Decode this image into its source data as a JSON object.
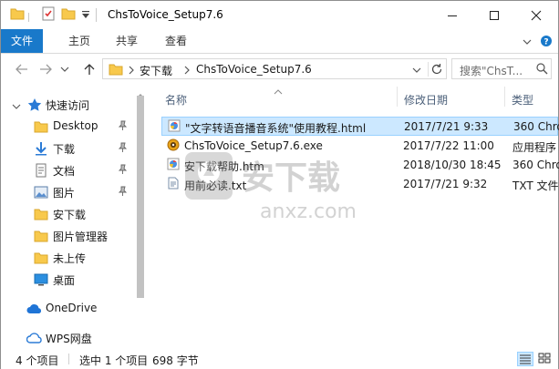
{
  "window": {
    "title": "ChsToVoice_Setup7.6"
  },
  "ribbon": {
    "tabs": [
      "文件",
      "主页",
      "共享",
      "查看"
    ]
  },
  "address": {
    "crumbs": [
      "安下载",
      "ChsToVoice_Setup7.6"
    ],
    "search_placeholder": "搜索\"ChsT..."
  },
  "sidebar": {
    "items": [
      {
        "label": "快速访问",
        "icon": "star-icon"
      },
      {
        "label": "Desktop",
        "icon": "folder-icon"
      },
      {
        "label": "下载",
        "icon": "download-icon"
      },
      {
        "label": "文档",
        "icon": "document-icon"
      },
      {
        "label": "图片",
        "icon": "picture-icon"
      },
      {
        "label": "安下载",
        "icon": "folder-icon"
      },
      {
        "label": "图片管理器",
        "icon": "folder-icon"
      },
      {
        "label": "未上传",
        "icon": "folder-icon"
      },
      {
        "label": "桌面",
        "icon": "desktop-icon"
      },
      {
        "label": "OneDrive",
        "icon": "cloud-icon"
      },
      {
        "label": "WPS网盘",
        "icon": "cloud-icon"
      }
    ]
  },
  "columns": {
    "name": "名称",
    "modified": "修改日期",
    "type": "类型"
  },
  "files": [
    {
      "name": "\"文字转语音播音系统\"使用教程.html",
      "modified": "2017/7/21 9:33",
      "type": "360 Chro",
      "icon": "html-icon",
      "selected": true
    },
    {
      "name": "ChsToVoice_Setup7.6.exe",
      "modified": "2017/7/22 11:00",
      "type": "应用程序",
      "icon": "exe-icon",
      "selected": false
    },
    {
      "name": "安下载帮助.htm",
      "modified": "2018/10/30 18:45",
      "type": "360 Chro",
      "icon": "html-icon",
      "selected": false
    },
    {
      "name": "用前必读.txt",
      "modified": "2017/7/21 9:32",
      "type": "TXT 文件",
      "icon": "txt-icon",
      "selected": false
    }
  ],
  "status": {
    "count": "4 个项目",
    "selection": "选中 1 个项目",
    "size": "698 字节"
  },
  "watermark": {
    "text": "安下载",
    "url": "anxz.com"
  },
  "colors": {
    "accent": "#1979ca",
    "selection_bg": "#cce8ff",
    "folder": "#f8c94c"
  }
}
